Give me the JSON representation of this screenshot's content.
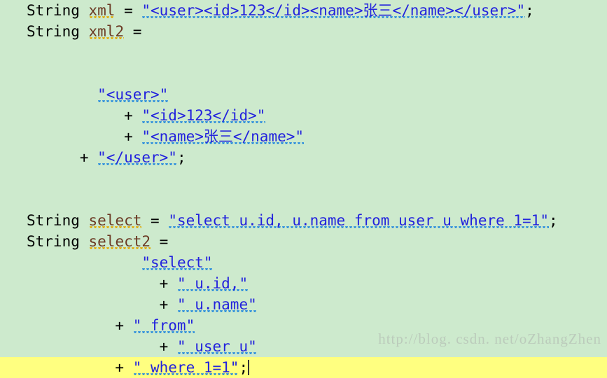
{
  "editor": {
    "background_color": "#cdeacd",
    "highlight_line_color": "#ffff80",
    "string_color": "#2222dd",
    "variable_color": "#6b3a24",
    "text_color": "#000000",
    "squiggle_warning_color": "#e0a800",
    "squiggle_spellcheck_color": "#2288dd",
    "caret_color": "#333333",
    "language": "Java"
  },
  "watermark": {
    "text": "http://blog. csdn. net/oZhangZhen",
    "color": "#b9c6b9"
  },
  "lines": [
    {
      "id": "line-1",
      "highlighted": false,
      "tokens": [
        {
          "type": "plain",
          "text": "String "
        },
        {
          "type": "var",
          "text": "xml"
        },
        {
          "type": "plain",
          "text": " = "
        },
        {
          "type": "str",
          "text": "\"<user><id>123</id><name>张三</name></user>\""
        },
        {
          "type": "plain",
          "text": ";"
        }
      ]
    },
    {
      "id": "line-2",
      "highlighted": false,
      "tokens": [
        {
          "type": "plain",
          "text": "String "
        },
        {
          "type": "var",
          "text": "xml2"
        },
        {
          "type": "plain",
          "text": " ="
        }
      ]
    },
    {
      "id": "line-3",
      "highlighted": false,
      "tokens": []
    },
    {
      "id": "line-4",
      "highlighted": false,
      "tokens": []
    },
    {
      "id": "line-5",
      "highlighted": false,
      "tokens": [
        {
          "type": "plain",
          "text": "        "
        },
        {
          "type": "str",
          "text": "\"<user>\""
        }
      ]
    },
    {
      "id": "line-6",
      "highlighted": false,
      "tokens": [
        {
          "type": "plain",
          "text": "           + "
        },
        {
          "type": "str",
          "text": "\"<id>123</id>\""
        }
      ]
    },
    {
      "id": "line-7",
      "highlighted": false,
      "tokens": [
        {
          "type": "plain",
          "text": "           + "
        },
        {
          "type": "str",
          "text": "\"<name>张三</name>\""
        }
      ]
    },
    {
      "id": "line-8",
      "highlighted": false,
      "tokens": [
        {
          "type": "plain",
          "text": "      + "
        },
        {
          "type": "str",
          "text": "\"</user>\""
        },
        {
          "type": "plain",
          "text": ";"
        }
      ]
    },
    {
      "id": "line-9",
      "highlighted": false,
      "tokens": []
    },
    {
      "id": "line-10",
      "highlighted": false,
      "tokens": []
    },
    {
      "id": "line-11",
      "highlighted": false,
      "tokens": [
        {
          "type": "plain",
          "text": "String "
        },
        {
          "type": "var",
          "text": "select"
        },
        {
          "type": "plain",
          "text": " = "
        },
        {
          "type": "str",
          "text": "\"select u.id, u.name from user u where 1=1\""
        },
        {
          "type": "plain",
          "text": ";"
        }
      ]
    },
    {
      "id": "line-12",
      "highlighted": false,
      "tokens": [
        {
          "type": "plain",
          "text": "String "
        },
        {
          "type": "var",
          "text": "select2"
        },
        {
          "type": "plain",
          "text": " ="
        }
      ]
    },
    {
      "id": "line-13",
      "highlighted": false,
      "tokens": [
        {
          "type": "plain",
          "text": "             "
        },
        {
          "type": "str",
          "text": "\"select\""
        }
      ]
    },
    {
      "id": "line-14",
      "highlighted": false,
      "tokens": [
        {
          "type": "plain",
          "text": "               + "
        },
        {
          "type": "str",
          "text": "\" u.id,\""
        }
      ]
    },
    {
      "id": "line-15",
      "highlighted": false,
      "tokens": [
        {
          "type": "plain",
          "text": "               + "
        },
        {
          "type": "str",
          "text": "\" u.name\""
        }
      ]
    },
    {
      "id": "line-16",
      "highlighted": false,
      "tokens": [
        {
          "type": "plain",
          "text": "          + "
        },
        {
          "type": "str",
          "text": "\" from\""
        }
      ]
    },
    {
      "id": "line-17",
      "highlighted": false,
      "tokens": [
        {
          "type": "plain",
          "text": "               + "
        },
        {
          "type": "str",
          "text": "\" user u\""
        }
      ]
    },
    {
      "id": "line-18",
      "highlighted": true,
      "caret": true,
      "tokens": [
        {
          "type": "plain",
          "text": "          + "
        },
        {
          "type": "str",
          "text": "\" where 1=1\""
        },
        {
          "type": "plain",
          "text": ";"
        }
      ]
    }
  ]
}
